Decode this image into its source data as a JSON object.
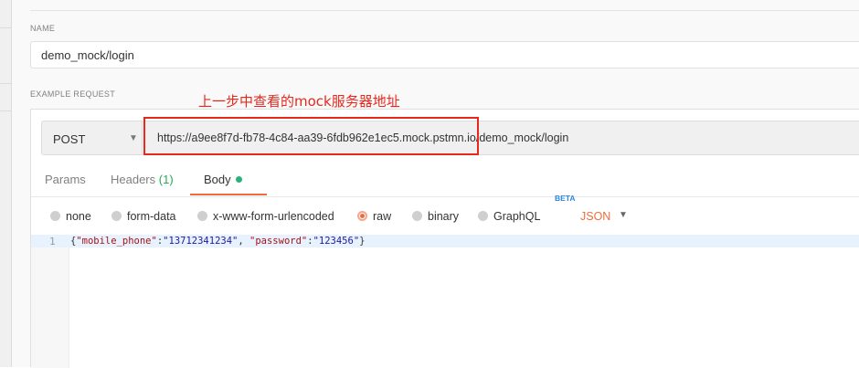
{
  "name_section": {
    "label": "NAME",
    "value": "demo_mock/login"
  },
  "example_section": {
    "label": "EXAMPLE REQUEST"
  },
  "annotation": {
    "text": "上一步中查看的mock服务器地址",
    "color": "#e8281d"
  },
  "request": {
    "method": "POST",
    "url": "https://a9ee8f7d-fb78-4c84-aa39-6fdb962e1ec5.mock.pstmn.io/demo_mock/login"
  },
  "tabs": [
    {
      "label": "Params"
    },
    {
      "label": "Headers",
      "count": "(1)"
    },
    {
      "label": "Body",
      "active": true
    }
  ],
  "body_types": [
    {
      "label": "none",
      "selected": false
    },
    {
      "label": "form-data",
      "selected": false
    },
    {
      "label": "x-www-form-urlencoded",
      "selected": false
    },
    {
      "label": "raw",
      "selected": true
    },
    {
      "label": "binary",
      "selected": false
    },
    {
      "label": "GraphQL",
      "selected": false,
      "badge": "BETA"
    }
  ],
  "raw_language": "JSON",
  "editor": {
    "line_number": "1",
    "code": {
      "key1": "\"mobile_phone\"",
      "val1": "\"13712341234\"",
      "key2": "\"password\"",
      "val2": "\"123456\""
    }
  },
  "colors": {
    "accent": "#f26b3a",
    "annotation_red": "#e8281d",
    "count_green": "#26a958",
    "beta_blue": "#2d87e2"
  }
}
